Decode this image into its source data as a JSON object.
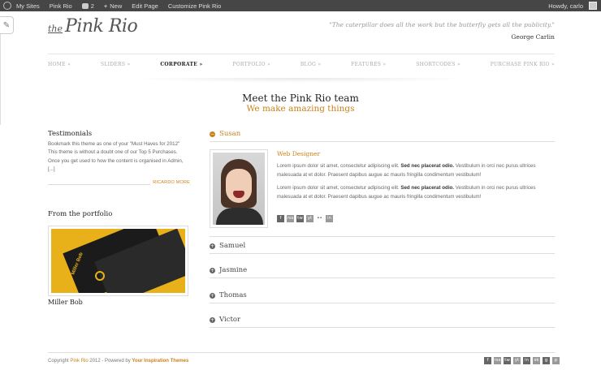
{
  "admin_bar": {
    "items": [
      "My Sites",
      "Pink Rio",
      "2",
      "New",
      "Edit Page",
      "Customize Pink Rio"
    ],
    "howdy": "Howdy, carlo"
  },
  "edit_tab_glyph": "✎",
  "logo": {
    "prefix": "the",
    "name": "Pink Rio"
  },
  "header": {
    "quote": "\"The caterpillar does all the work but the butterfly gets all the publicity.\"",
    "author": "George Carlin"
  },
  "nav": [
    "HOME »",
    "SLIDERS »",
    "CORPORATE »",
    "PORTFOLIO »",
    "BLOG »",
    "FEATURES »",
    "SHORTCODES »",
    "PURCHASE PINK RIO »"
  ],
  "page": {
    "title": "Meet the Pink Rio team",
    "subtitle": "We make amazing things"
  },
  "testimonials": {
    "title": "Testimonials",
    "lines": [
      "Bookmark this theme as one of your \"Must Haves for 2012\"",
      "This theme is without a doubt one of our Top 5 Purchases.",
      "Once you get used to how the content is organised in Admin,",
      "[...]"
    ],
    "more": "RICARDO MORE"
  },
  "portfolio": {
    "title": "From the portfolio",
    "card_text": "Miller Bob",
    "caption": "Miller Bob"
  },
  "team": {
    "open_member": {
      "name": "Susan",
      "role": "Web Designer",
      "bio1_prefix": "Lorem ipsum dolor sit amet, consectetur adipiscing elit. ",
      "bio1_bold": "Sed nec placerat odio.",
      "bio1_suffix": " Vestibulum in orci nec purus ultrices",
      "bio1_line2": "malesuada at et dolor. Praesent dapibus augue ac mauris fringilla condimentum vestibulum!",
      "bio2_prefix": "Lorem ipsum dolor sit amet, consectetur adipiscing elit. ",
      "bio2_bold": "Sed nec placerat odio.",
      "bio2_suffix": " Vestibulum in orci nec purus ultrices",
      "bio2_line2": "malesuada at et dolor. Praesent dapibus augue ac mauris fringilla condimentum vestibulum!",
      "social": [
        "f",
        "rss",
        "tw",
        "yt",
        "••",
        "in"
      ]
    },
    "closed_members": [
      "Samuel",
      "Jasmine",
      "Thomas",
      "Victor"
    ],
    "open_glyph": "−",
    "closed_glyph": "+"
  },
  "footer": {
    "prefix": "Copyright ",
    "brand": "Pink Rio",
    "middle": " 2012 - Powered by ",
    "link": "Your Inspiration Themes",
    "social": [
      "f",
      "rss",
      "tw",
      "yt",
      "in",
      "sk",
      "g",
      "p"
    ]
  },
  "colors": {
    "accent": "#c8821a",
    "admin_bar": "#464646",
    "text": "#555555"
  }
}
